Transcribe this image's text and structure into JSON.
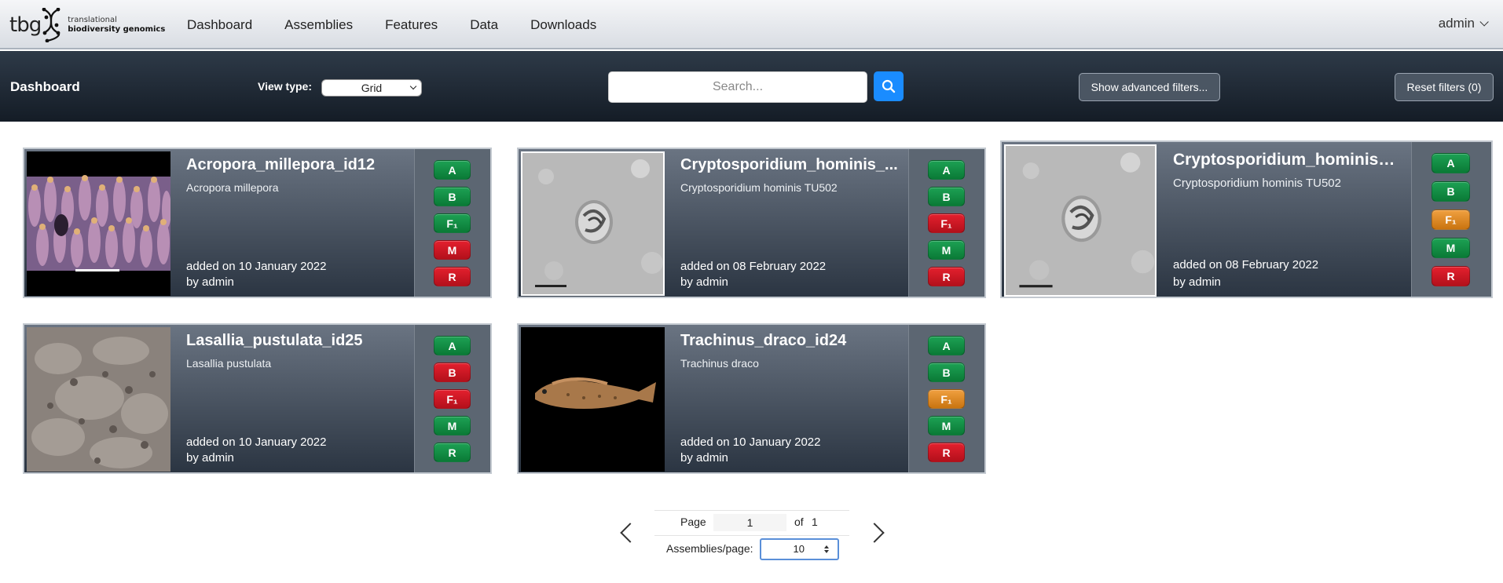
{
  "navbar": {
    "logo": {
      "short": "tbg",
      "line1": "translational",
      "line2": "biodiversity genomics"
    },
    "items": [
      {
        "label": "Dashboard"
      },
      {
        "label": "Assemblies"
      },
      {
        "label": "Features"
      },
      {
        "label": "Data"
      },
      {
        "label": "Downloads"
      }
    ],
    "user": "admin"
  },
  "toolbar": {
    "title": "Dashboard",
    "view_type_label": "View type:",
    "view_type_value": "Grid",
    "search_placeholder": "Search...",
    "advanced_filters": "Show advanced filters...",
    "reset_filters": "Reset filters (0)"
  },
  "cards": [
    {
      "name": "Acropora_millepora_id12",
      "species": "Acropora millepora",
      "added": "added on 10 January 2022",
      "by": "by admin",
      "badges": [
        {
          "label": "A",
          "status": "green"
        },
        {
          "label": "B",
          "status": "green"
        },
        {
          "label": "F₁",
          "status": "green"
        },
        {
          "label": "M",
          "status": "red"
        },
        {
          "label": "R",
          "status": "red"
        }
      ]
    },
    {
      "name": "Cryptosporidium_hominis_...",
      "species": "Cryptosporidium hominis TU502",
      "added": "added on 08 February 2022",
      "by": "by admin",
      "badges": [
        {
          "label": "A",
          "status": "green"
        },
        {
          "label": "B",
          "status": "green"
        },
        {
          "label": "F₁",
          "status": "red"
        },
        {
          "label": "M",
          "status": "green"
        },
        {
          "label": "R",
          "status": "red"
        }
      ]
    },
    {
      "name": "Cryptosporidium_hominis_...",
      "species": "Cryptosporidium hominis TU502",
      "added": "added on 08 February 2022",
      "by": "by admin",
      "badges": [
        {
          "label": "A",
          "status": "green"
        },
        {
          "label": "B",
          "status": "green"
        },
        {
          "label": "F₁",
          "status": "orange"
        },
        {
          "label": "M",
          "status": "green"
        },
        {
          "label": "R",
          "status": "red"
        }
      ]
    },
    {
      "name": "Lasallia_pustulata_id25",
      "species": "Lasallia pustulata",
      "added": "added on 10 January 2022",
      "by": "by admin",
      "badges": [
        {
          "label": "A",
          "status": "green"
        },
        {
          "label": "B",
          "status": "red"
        },
        {
          "label": "F₁",
          "status": "red"
        },
        {
          "label": "M",
          "status": "green"
        },
        {
          "label": "R",
          "status": "green"
        }
      ]
    },
    {
      "name": "Trachinus_draco_id24",
      "species": "Trachinus draco",
      "added": "added on 10 January 2022",
      "by": "by admin",
      "badges": [
        {
          "label": "A",
          "status": "green"
        },
        {
          "label": "B",
          "status": "green"
        },
        {
          "label": "F₁",
          "status": "orange"
        },
        {
          "label": "M",
          "status": "green"
        },
        {
          "label": "R",
          "status": "red"
        }
      ]
    }
  ],
  "pagination": {
    "page_label": "Page",
    "page_value": "1",
    "of_label": "of",
    "total_pages": "1",
    "per_page_label": "Assemblies/page:",
    "per_page_value": "10"
  }
}
